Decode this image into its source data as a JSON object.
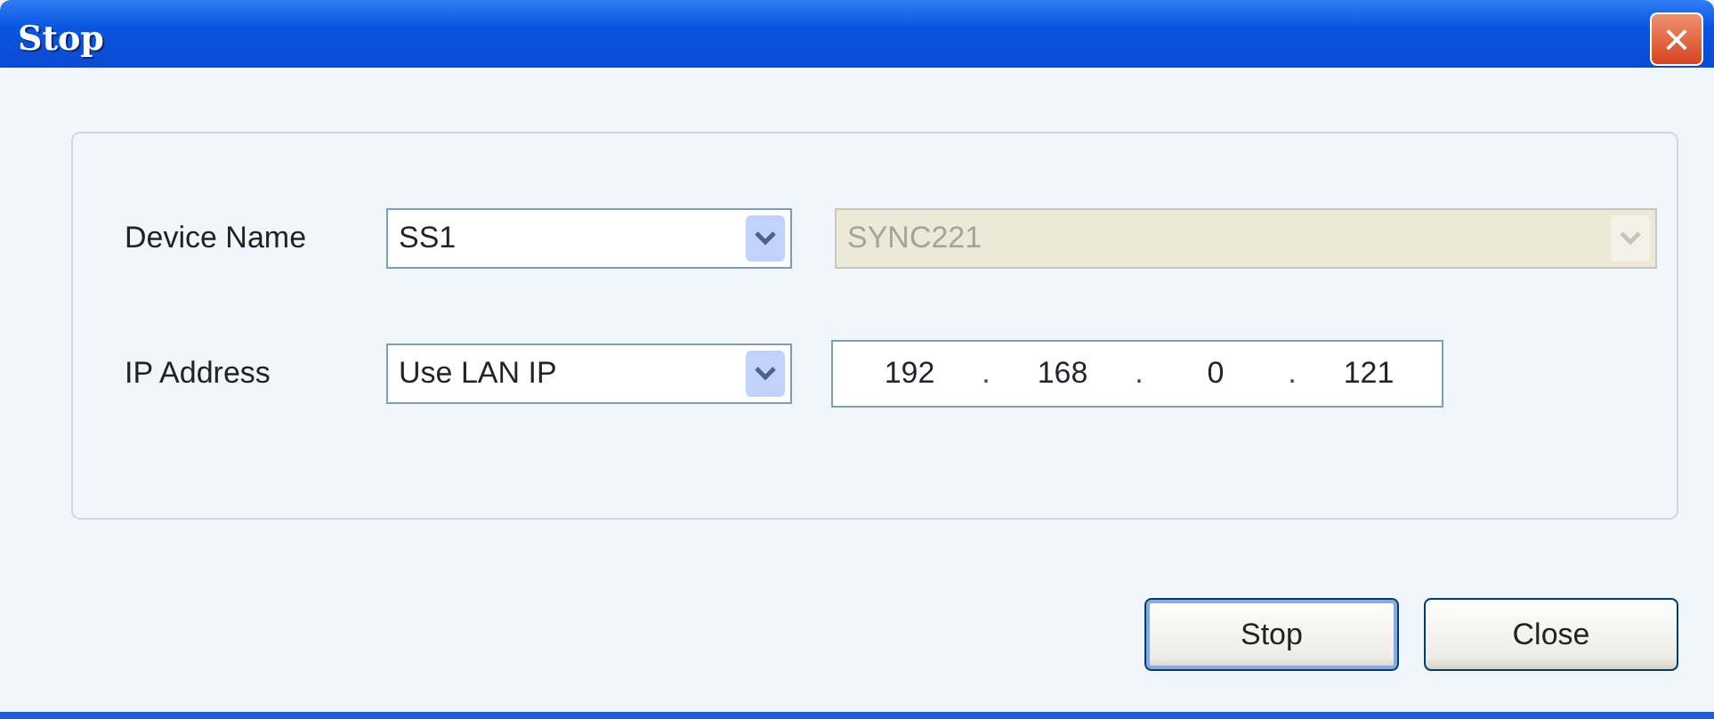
{
  "window": {
    "title": "Stop",
    "close": "×"
  },
  "rows": [
    {
      "label": "Device Name",
      "combos": [
        {
          "value": "SS1",
          "disabled": false
        },
        {
          "value": "SYNC221",
          "disabled": true
        }
      ]
    },
    {
      "label": "IP Address",
      "combos": [
        {
          "value": "Use LAN IP",
          "disabled": false
        }
      ],
      "ip": [
        "192",
        "168",
        "0",
        "121"
      ],
      "ip_separator": "."
    }
  ],
  "buttons": [
    {
      "label": "Stop",
      "default": true
    },
    {
      "label": "Close",
      "default": false
    }
  ]
}
